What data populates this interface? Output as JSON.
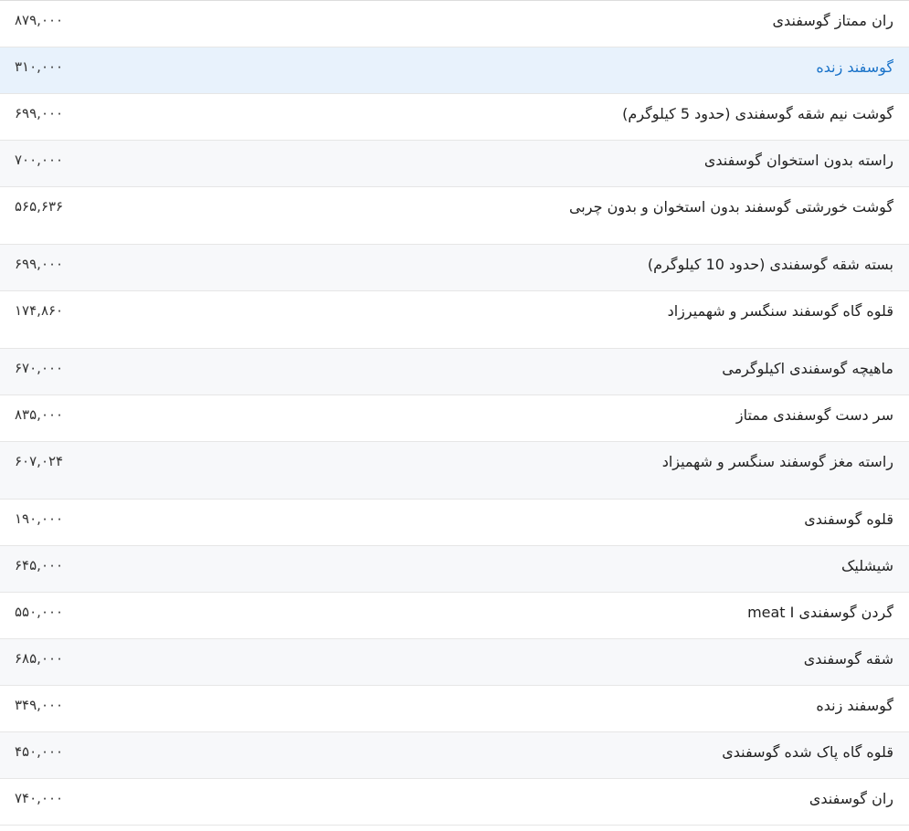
{
  "products": [
    {
      "name": "ران ممتاز گوسفندی",
      "price": "۸۷۹,۰۰۰"
    },
    {
      "name": "گوسفند زنده",
      "price": "۳۱۰,۰۰۰"
    },
    {
      "name": "گوشت نیم شقه گوسفندی (حدود 5 کیلوگرم)",
      "price": "۶۹۹,۰۰۰"
    },
    {
      "name": "راسته بدون استخوان گوسفندی",
      "price": "۷۰۰,۰۰۰"
    },
    {
      "name": "گوشت خورشتی گوسفند بدون استخوان و بدون چربی",
      "price": "۵۶۵,۶۳۶"
    },
    {
      "name": "بسته شقه گوسفندی (حدود 10 کیلوگرم)",
      "price": "۶۹۹,۰۰۰"
    },
    {
      "name": "قلوه گاه گوسفند سنگسر و شهمیرزاد",
      "price": "۱۷۴,۸۶۰"
    },
    {
      "name": "ماهیچه گوسفندی اکیلوگرمی",
      "price": "۶۷۰,۰۰۰"
    },
    {
      "name": "سر دست گوسفندی ممتاز",
      "price": "۸۳۵,۰۰۰"
    },
    {
      "name": "راسته مغز گوسفند سنگسر و شهمیزاد",
      "price": "۶۰۷,۰۲۴"
    },
    {
      "name": "قلوه گوسفندی",
      "price": "۱۹۰,۰۰۰"
    },
    {
      "name": "شیشلیک",
      "price": "۶۴۵,۰۰۰"
    },
    {
      "name": "گردن گوسفندی meat I",
      "price": "۵۵۰,۰۰۰"
    },
    {
      "name": "شقه گوسفندی",
      "price": "۶۸۵,۰۰۰"
    },
    {
      "name": "گوسفند زنده",
      "price": "۳۴۹,۰۰۰"
    },
    {
      "name": "قلوه گاه پاک شده گوسفندی",
      "price": "۴۵۰,۰۰۰"
    },
    {
      "name": "ران گوسفندی",
      "price": "۷۴۰,۰۰۰"
    }
  ],
  "highlighted_row": 1,
  "colors": {
    "highlight_background": "#e8f2fc",
    "highlight_text": "#1a73c9",
    "alt_row_background": "#f7f8fa"
  }
}
